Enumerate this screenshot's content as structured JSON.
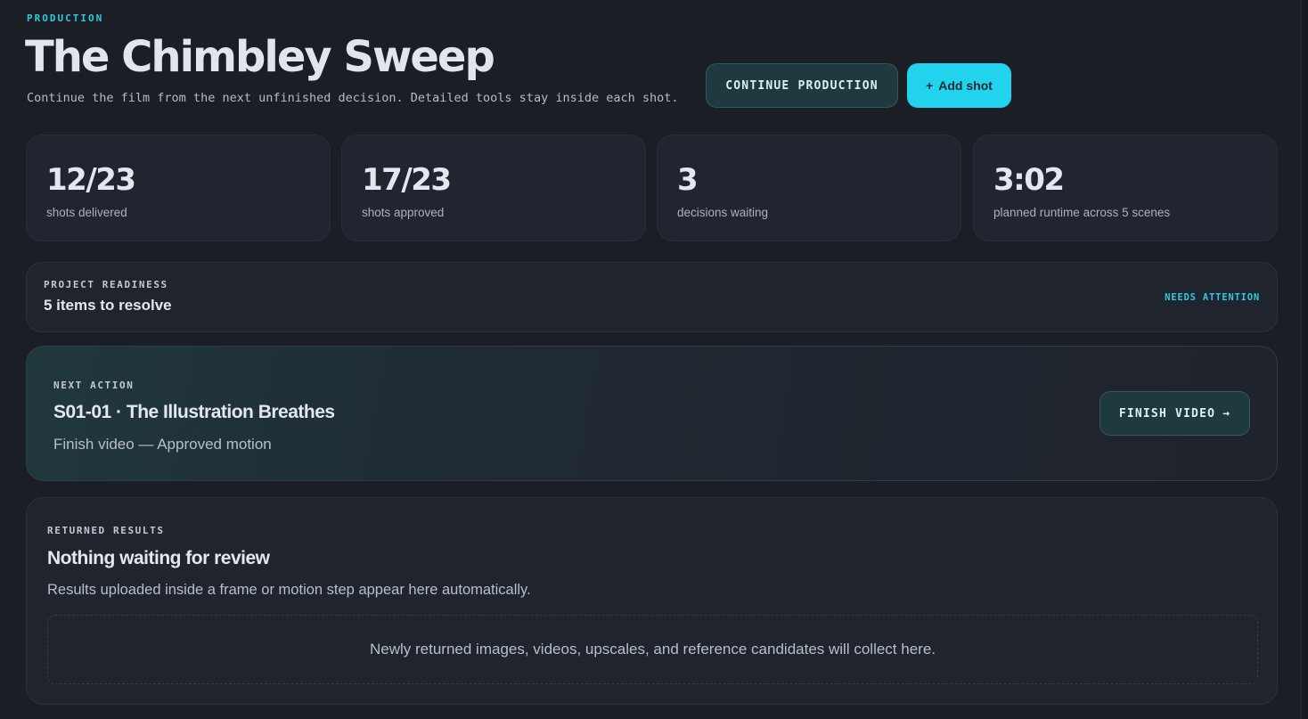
{
  "header": {
    "eyebrow": "PRODUCTION",
    "title": "The Chimbley Sweep",
    "subtitle": "Continue the film from the next unfinished decision. Detailed tools stay inside each shot.",
    "continue_label": "CONTINUE PRODUCTION",
    "add_icon": "+",
    "add_label": "Add shot"
  },
  "stats": [
    {
      "value": "12/23",
      "label": "shots delivered"
    },
    {
      "value": "17/23",
      "label": "shots approved"
    },
    {
      "value": "3",
      "label": "decisions waiting"
    },
    {
      "value": "3:02",
      "label": "planned runtime across 5 scenes"
    }
  ],
  "readiness": {
    "label": "PROJECT READINESS",
    "value": "5 items to resolve",
    "status": "NEEDS ATTENTION"
  },
  "next_action": {
    "label": "NEXT ACTION",
    "shot": "S01-01 · The Illustration Breathes",
    "detail": "Finish video — Approved motion",
    "button_label": "FINISH VIDEO",
    "button_icon": "→"
  },
  "returned": {
    "label": "RETURNED RESULTS",
    "heading": "Nothing waiting for review",
    "description": "Results uploaded inside a frame or motion step appear here automatically.",
    "empty_text": "Newly returned images, videos, upscales, and reference candidates will collect here."
  },
  "colors": {
    "accent": "#22d3ee",
    "background": "#1b1f25",
    "card": "#202530"
  }
}
